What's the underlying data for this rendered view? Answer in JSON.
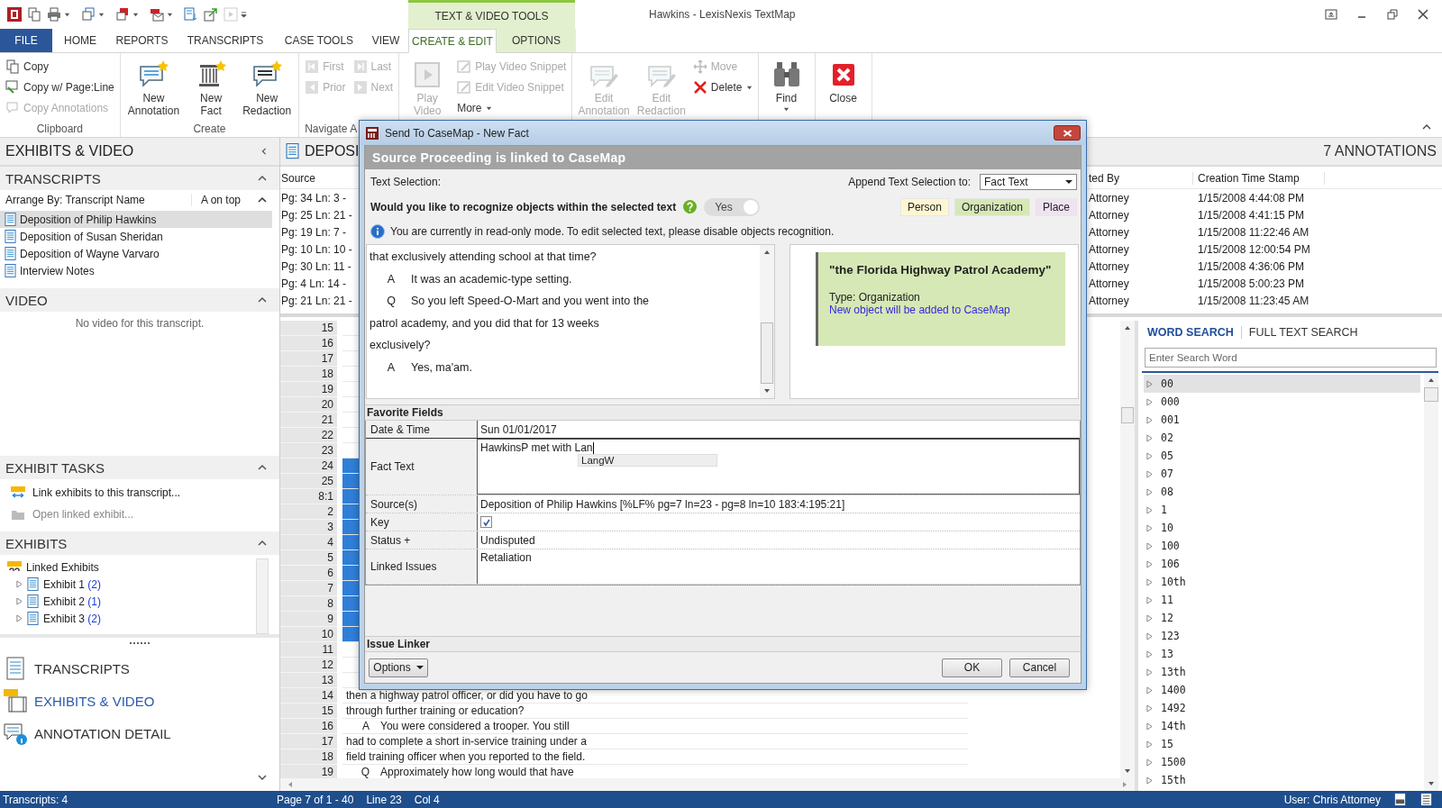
{
  "window": {
    "title": "Hawkins - LexisNexis TextMap",
    "context_tab_group": "TEXT & VIDEO TOOLS"
  },
  "tabs": [
    {
      "label": "FILE",
      "kind": "file",
      "selected": false
    },
    {
      "label": "HOME",
      "kind": "normal",
      "selected": false
    },
    {
      "label": "REPORTS",
      "kind": "normal",
      "selected": false
    },
    {
      "label": "TRANSCRIPTS",
      "kind": "normal",
      "selected": false
    },
    {
      "label": "CASE TOOLS",
      "kind": "normal",
      "selected": false
    },
    {
      "label": "VIEW",
      "kind": "normal",
      "selected": false
    },
    {
      "label": "CREATE & EDIT",
      "kind": "context",
      "selected": true
    },
    {
      "label": "OPTIONS",
      "kind": "context",
      "selected": false
    }
  ],
  "ribbon": {
    "groups": [
      {
        "label": "Clipboard",
        "columns": [
          [
            {
              "label": "Copy",
              "kind": "small",
              "disabled": false
            },
            {
              "label": "Copy w/ Page:Line",
              "kind": "small",
              "disabled": false
            },
            {
              "label": "Copy Annotations",
              "kind": "small",
              "disabled": true
            }
          ]
        ]
      },
      {
        "label": "Create",
        "columns": [
          [
            {
              "label": "New\nAnnotation",
              "kind": "large",
              "disabled": false
            }
          ],
          [
            {
              "label": "New\nFact",
              "kind": "large",
              "disabled": false
            }
          ],
          [
            {
              "label": "New\nRedaction",
              "kind": "large",
              "disabled": false
            }
          ]
        ]
      },
      {
        "label": "Navigate A",
        "columns": [
          [
            {
              "label": "First",
              "kind": "small",
              "disabled": true
            },
            {
              "label": "Prior",
              "kind": "small",
              "disabled": true
            }
          ],
          [
            {
              "label": "Last",
              "kind": "small",
              "disabled": true
            },
            {
              "label": "Next",
              "kind": "small",
              "disabled": true
            }
          ]
        ]
      },
      {
        "columns": [
          [
            {
              "label": "Play\nVideo",
              "kind": "large",
              "disabled": true
            }
          ],
          [
            {
              "label": "Play Video Snippet",
              "kind": "small",
              "disabled": true
            },
            {
              "label": "Edit Video Snippet",
              "kind": "small",
              "disabled": true
            },
            {
              "label": "More",
              "kind": "small",
              "disabled": false,
              "dropdown": true
            }
          ]
        ]
      },
      {
        "columns": [
          [
            {
              "label": "Edit\nAnnotation",
              "kind": "large",
              "disabled": true
            }
          ],
          [
            {
              "label": "Edit\nRedaction",
              "kind": "large",
              "disabled": true
            }
          ],
          [
            {
              "label": "Move",
              "kind": "small",
              "disabled": true
            },
            {
              "label": "Delete",
              "kind": "small",
              "disabled": false,
              "dropdown": true
            }
          ]
        ]
      },
      {
        "columns": [
          [
            {
              "label": "Find",
              "kind": "large",
              "disabled": false,
              "dropdown": true
            }
          ]
        ]
      },
      {
        "columns": [
          [
            {
              "label": "Close",
              "kind": "large",
              "disabled": false
            }
          ]
        ]
      }
    ]
  },
  "left_panel": {
    "title": "EXHIBITS & VIDEO",
    "transcripts": {
      "title": "TRANSCRIPTS",
      "arrange_by": "Arrange By: Transcript Name",
      "sort": "A on top",
      "items": [
        {
          "label": "Deposition of Philip Hawkins",
          "selected": true
        },
        {
          "label": "Deposition of Susan Sheridan",
          "selected": false
        },
        {
          "label": "Deposition of Wayne Varvaro",
          "selected": false
        },
        {
          "label": "Interview Notes",
          "selected": false
        }
      ]
    },
    "video": {
      "title": "VIDEO",
      "message": "No video for this transcript."
    },
    "exhibit_tasks": {
      "title": "EXHIBIT TASKS",
      "items": [
        {
          "label": "Link exhibits to this transcript...",
          "disabled": false
        },
        {
          "label": "Open linked exhibit...",
          "disabled": true
        }
      ]
    },
    "exhibits": {
      "title": "EXHIBITS",
      "tree": [
        {
          "label": "Linked Exhibits",
          "children": [
            {
              "label": "Exhibit 1",
              "count": "(2)"
            },
            {
              "label": "Exhibit 2",
              "count": "(1)"
            },
            {
              "label": "Exhibit 3",
              "count": "(2)"
            }
          ]
        }
      ]
    },
    "nav": [
      {
        "label": "TRANSCRIPTS",
        "selected": false
      },
      {
        "label": "EXHIBITS & VIDEO",
        "selected": true
      },
      {
        "label": "ANNOTATION DETAIL",
        "selected": false
      }
    ]
  },
  "annotations": {
    "document_title": "DEPOSI",
    "count_label": "7 ANNOTATIONS",
    "columns": [
      "Source",
      "ted By",
      "Creation Time Stamp"
    ],
    "rows": [
      [
        "Pg: 34 Ln: 3 -",
        "Attorney",
        "1/15/2008 4:44:08 PM"
      ],
      [
        "Pg: 25 Ln: 21 -",
        "Attorney",
        "1/15/2008 4:41:15 PM"
      ],
      [
        "Pg: 19 Ln: 7 -",
        "Attorney",
        "1/15/2008 11:22:46 AM"
      ],
      [
        "Pg: 10 Ln: 10 -",
        "Attorney",
        "1/15/2008 12:00:54 PM"
      ],
      [
        "Pg: 30 Ln: 11 -",
        "Attorney",
        "1/15/2008 4:36:06 PM"
      ],
      [
        "Pg: 4 Ln: 14 -",
        "Attorney",
        "1/15/2008 5:00:23 PM"
      ],
      [
        "Pg: 21 Ln: 21 -",
        "Attorney",
        "1/15/2008 11:23:45 AM"
      ]
    ]
  },
  "transcript": {
    "lines": [
      {
        "number": "15",
        "selected": false
      },
      {
        "number": "16",
        "selected": false
      },
      {
        "number": "17",
        "selected": false
      },
      {
        "number": "18",
        "selected": false
      },
      {
        "number": "19",
        "selected": false
      },
      {
        "number": "20",
        "selected": false
      },
      {
        "number": "21",
        "selected": false
      },
      {
        "number": "22",
        "selected": false
      },
      {
        "number": "23",
        "selected": false
      },
      {
        "number": "24",
        "selected": true
      },
      {
        "number": "25",
        "selected": true
      },
      {
        "number": "8:1",
        "selected": true
      },
      {
        "number": "2",
        "selected": true
      },
      {
        "number": "3",
        "selected": true
      },
      {
        "number": "4",
        "selected": true
      },
      {
        "number": "5",
        "selected": true
      },
      {
        "number": "6",
        "selected": true
      },
      {
        "number": "7",
        "selected": true
      },
      {
        "number": "8",
        "selected": true
      },
      {
        "number": "9",
        "selected": true
      },
      {
        "number": "10",
        "selected": true
      },
      {
        "number": "11",
        "selected": false
      },
      {
        "number": "12",
        "selected": false
      },
      {
        "number": "13",
        "selected": false
      },
      {
        "number": "14",
        "selected": false,
        "text": "then a highway patrol officer, or did you have to go"
      },
      {
        "number": "15",
        "selected": false,
        "text": "through further training or education?"
      },
      {
        "number": "16",
        "selected": false,
        "speaker": "A",
        "text": "You were considered a trooper.  You still"
      },
      {
        "number": "17",
        "selected": false,
        "text": "had to complete a short in-service training under a"
      },
      {
        "number": "18",
        "selected": false,
        "text": "field training officer when you reported to the field."
      },
      {
        "number": "19",
        "selected": false,
        "speaker": "Q",
        "text": "Approximately how long would that have"
      }
    ]
  },
  "search": {
    "tabs": [
      {
        "label": "WORD SEARCH",
        "selected": true
      },
      {
        "label": "FULL TEXT SEARCH",
        "selected": false
      }
    ],
    "placeholder": "Enter Search Word",
    "words": [
      {
        "label": "00",
        "selected": true
      },
      {
        "label": "000",
        "selected": false
      },
      {
        "label": "001",
        "selected": false
      },
      {
        "label": "02",
        "selected": false
      },
      {
        "label": "05",
        "selected": false
      },
      {
        "label": "07",
        "selected": false
      },
      {
        "label": "08",
        "selected": false
      },
      {
        "label": "1",
        "selected": false
      },
      {
        "label": "10",
        "selected": false
      },
      {
        "label": "100",
        "selected": false
      },
      {
        "label": "106",
        "selected": false
      },
      {
        "label": "10th",
        "selected": false
      },
      {
        "label": "11",
        "selected": false
      },
      {
        "label": "12",
        "selected": false
      },
      {
        "label": "123",
        "selected": false
      },
      {
        "label": "13",
        "selected": false
      },
      {
        "label": "13th",
        "selected": false
      },
      {
        "label": "1400",
        "selected": false
      },
      {
        "label": "1492",
        "selected": false
      },
      {
        "label": "14th",
        "selected": false
      },
      {
        "label": "15",
        "selected": false
      },
      {
        "label": "1500",
        "selected": false
      },
      {
        "label": "15th",
        "selected": false
      }
    ]
  },
  "dialog": {
    "title": "Send To CaseMap - New Fact",
    "banner": "Source Proceeding is linked to CaseMap",
    "text_selection_label": "Text Selection:",
    "append_label": "Append Text Selection to:",
    "append_value": "Fact Text",
    "recognize_question": "Would you like to recognize objects within the selected text",
    "recognize": {
      "on": true,
      "label": "Yes"
    },
    "object_types": [
      {
        "label": "Person",
        "color": "#fdf6d3"
      },
      {
        "label": "Organization",
        "color": "#d6e8b5"
      },
      {
        "label": "Place",
        "color": "#efe3f3"
      }
    ],
    "info": "You are currently in read-only mode. To edit selected text, please disable objects recognition.",
    "selected_text": [
      {
        "text": "that exclusively attending school at that time?"
      },
      {
        "speaker": "A",
        "text": "It was an academic-type setting."
      },
      {
        "speaker": "Q",
        "text": "So you left Speed-O-Mart and you went into the"
      },
      {
        "text": "patrol academy, and you did that for 13 weeks"
      },
      {
        "text": "exclusively?"
      },
      {
        "speaker": "A",
        "text": "Yes, ma'am."
      }
    ],
    "object": {
      "name": "\"the Florida Highway Patrol Academy\"",
      "type": "Type: Organization",
      "note": "New object will be added to CaseMap",
      "color": "#d6e8b5"
    },
    "favorite_fields_title": "Favorite Fields",
    "fields": [
      {
        "label": "Date & Time",
        "kind": "text",
        "value": "Sun 01/01/2017"
      },
      {
        "label": "Fact Text",
        "kind": "editor",
        "value": "HawkinsP met with Lan",
        "suggestion": "LangW"
      },
      {
        "label": "Source(s)",
        "kind": "text",
        "value": "Deposition of Philip Hawkins [%LF% pg=7 ln=23 - pg=8 ln=10 183:4:195:21]"
      },
      {
        "label": "Key",
        "kind": "checkbox",
        "checked": true
      },
      {
        "label": "Status +",
        "kind": "text",
        "value": "Undisputed"
      },
      {
        "label": "Linked Issues",
        "kind": "multiline",
        "value": "Retaliation"
      }
    ],
    "issue_linker_title": "Issue Linker",
    "buttons": {
      "options": "Options",
      "ok": "OK",
      "cancel": "Cancel"
    }
  },
  "status_bar": {
    "transcripts": "Transcripts: 4",
    "page": "Page 7 of 1 - 40",
    "line": "Line 23",
    "col": "Col 4",
    "user": "User: Chris Attorney"
  }
}
